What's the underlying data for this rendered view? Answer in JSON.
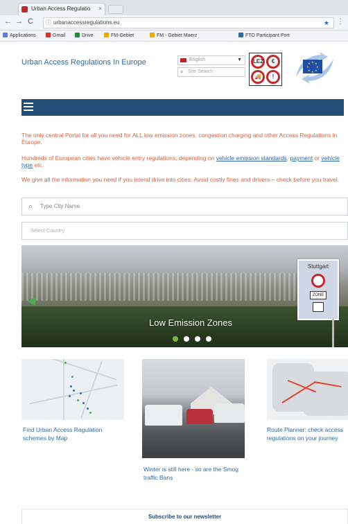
{
  "browser": {
    "tab_title": "Urban Access Regulatio",
    "tab_close": "×",
    "url": "urbanaccessregulations.eu",
    "back": "←",
    "forward": "→",
    "reload": "C",
    "bookmarks": [
      {
        "label": "Applications",
        "color": "#5b7fd6"
      },
      {
        "label": "Gmail",
        "color": "#d93025"
      },
      {
        "label": "Drive",
        "color": "#1e8e3e"
      },
      {
        "label": "FM-Gebiet",
        "color": "#f2a900"
      },
      {
        "label": "FM - Gebiet Maerz",
        "color": "#f2a900"
      },
      {
        "label": "FTO Participant Port",
        "color": "#2d6aa6"
      }
    ]
  },
  "header": {
    "site_title": "Urban Access Regulations In Europe",
    "language": "English",
    "search_placeholder": "Site Search",
    "sign_symbols": [
      "LEZ",
      "€",
      "🚚",
      "!"
    ]
  },
  "intro": {
    "p1": "The only central Portal for all you need for ALL low emission zones, congestion charging and other Access Regulations in Europe.",
    "p2_a": "Hundreds of European cities have vehicle entry regulations, depending on ",
    "p2_link1": "vehicle emission standards",
    "p2_b": ", ",
    "p2_link2": "payment",
    "p2_c": " or ",
    "p2_link3": "vehicle type",
    "p2_d": " etc.",
    "p3": "We give all the information you need if you intend drive into cities. Avoid costly fines and drivers – check before you travel."
  },
  "search": {
    "city_placeholder": "Type City Name",
    "country_placeholder": "Select Country"
  },
  "hero": {
    "caption": "Low Emission Zones",
    "sign_city": "Stuttgart",
    "sign_zone": "ZONE",
    "slides": 4,
    "active_slide": 1
  },
  "cards": [
    {
      "text": "Find Urban Access Regulation schemes by Map"
    },
    {
      "text": "Winter is still here - so are the Smog traffic Bans"
    },
    {
      "text": "Route Planner: check access regulations on your journey"
    }
  ],
  "newsletter": {
    "label": "Subscribe to our newsletter"
  },
  "colors": {
    "navbar": "#244d75",
    "intro_text": "#d9603a",
    "link": "#2d6aa6",
    "sign_red": "#c62828"
  }
}
